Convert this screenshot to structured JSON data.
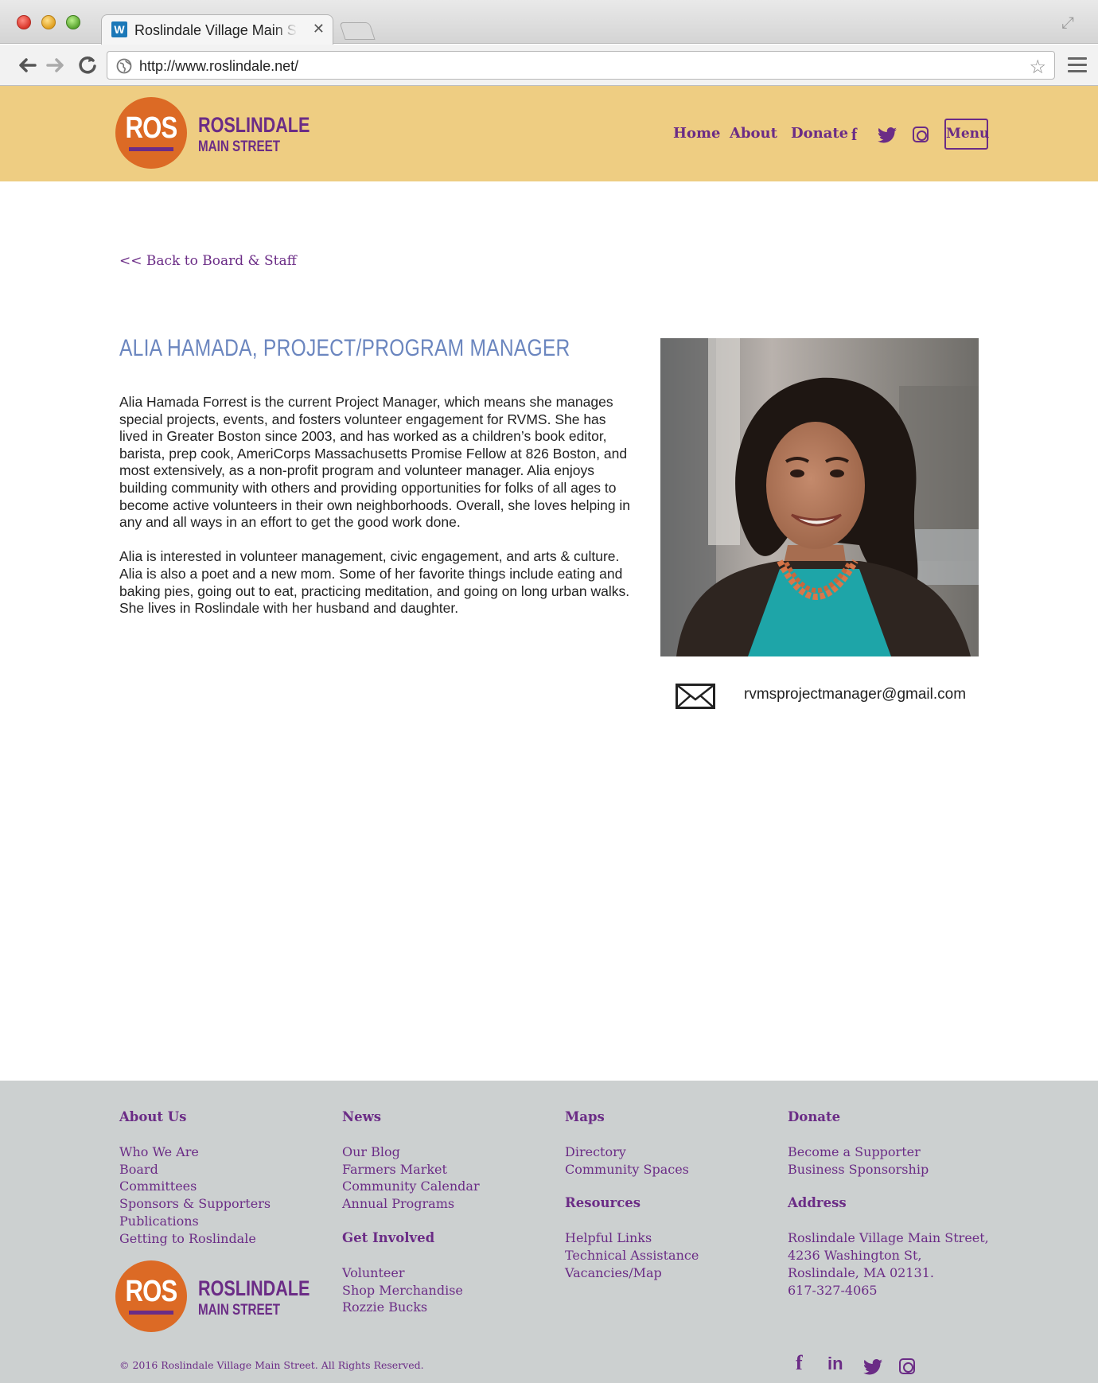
{
  "browser": {
    "tab_title": "Roslindale Village Main St",
    "favicon_letter": "W",
    "url": "http://www.roslindale.net/"
  },
  "header": {
    "logo_mark": "ROS",
    "logo_name": "ROSLINDALE",
    "logo_sub": "MAIN STREET",
    "nav": {
      "home": "Home",
      "about": "About",
      "donate": "Donate",
      "menu": "Menu"
    },
    "social_icons": [
      "facebook-icon",
      "twitter-icon",
      "instagram-icon"
    ]
  },
  "profile": {
    "back_link": "<< Back to Board & Staff",
    "title": "ALIA HAMADA, PROJECT/PROGRAM MANAGER",
    "bio_paragraph_1": "Alia Hamada Forrest is the current Project Manager, which means she manages special projects, events, and fosters volunteer engagement for RVMS. She has lived in Greater Boston since 2003, and has worked as a children’s book editor, barista, prep cook, AmeriCorps Massachusetts Promise Fellow at 826 Boston, and most extensively, as a non-profit program and volunteer manager. Alia enjoys building community with others and providing opportunities for folks of all ages to become active volunteers in their own neighborhoods. Overall, she loves helping in any and all ways in an effort to get the good work done.",
    "bio_paragraph_2": "Alia is interested in volunteer management, civic engagement, and arts & culture. Alia is also a poet and a new mom. Some of her favorite things include eating and baking pies, going out to eat, practicing meditation, and going on long urban walks. She lives in Roslindale with her husband and daughter.",
    "email": "rvmsprojectmanager@gmail.com"
  },
  "footer": {
    "about": {
      "heading": "About Us",
      "links": [
        "Who We Are",
        "Board",
        "Committees",
        "Sponsors & Supporters",
        "Publications",
        "Getting to Roslindale"
      ]
    },
    "news": {
      "heading": "News",
      "links": [
        "Our Blog",
        "Farmers Market",
        "Community Calendar",
        "Annual Programs"
      ]
    },
    "get_involved": {
      "heading": "Get Involved",
      "links": [
        "Volunteer",
        "Shop Merchandise",
        "Rozzie Bucks"
      ]
    },
    "maps": {
      "heading": "Maps",
      "links": [
        "Directory",
        "Community Spaces"
      ]
    },
    "resources": {
      "heading": "Resources",
      "links": [
        "Helpful Links",
        "Technical Assistance",
        "Vacancies/Map"
      ]
    },
    "donate": {
      "heading": "Donate",
      "links": [
        "Become a Supporter",
        "Business Sponsorship"
      ]
    },
    "address": {
      "heading": "Address",
      "lines": [
        "Roslindale Village Main Street,",
        "4236 Washington St,",
        "Roslindale, MA 02131.",
        "617-327-4065"
      ]
    },
    "copyright": "© 2016 Roslindale Village Main Street. All Rights Reserved.",
    "social_icons": [
      "facebook-icon",
      "linkedin-icon",
      "twitter-icon",
      "instagram-icon"
    ],
    "linkedin_glyph": "in",
    "facebook_glyph": "f"
  },
  "colors": {
    "header_bg": "#eecd82",
    "brand_purple": "#6b2c86",
    "logo_orange": "#dc6a25",
    "title_blue": "#6b86bf",
    "footer_bg": "#ccd0d0"
  }
}
